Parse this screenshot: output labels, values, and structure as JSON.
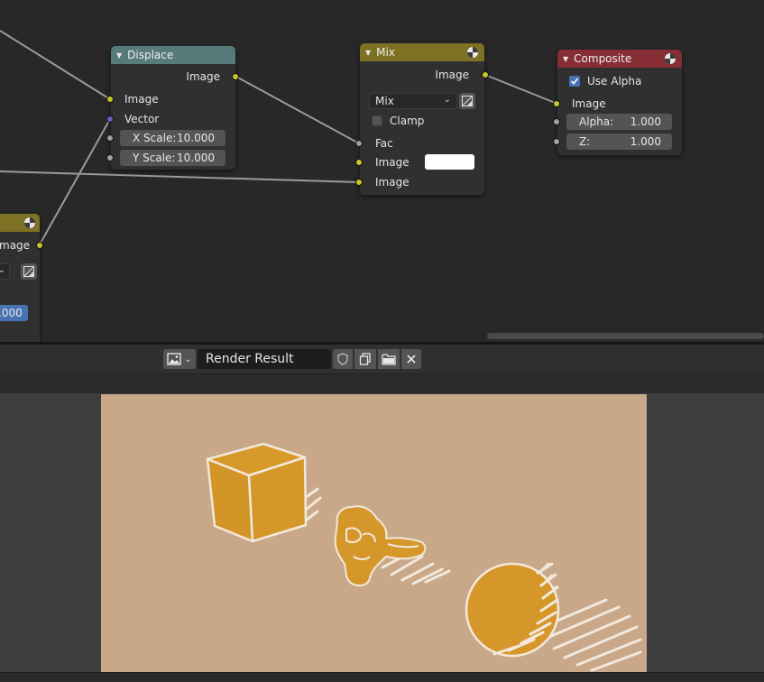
{
  "node_editor": {
    "nodes": {
      "displace": {
        "title": "Displace",
        "output_image": "Image",
        "input_image": "Image",
        "input_vector": "Vector",
        "x_scale_label": "X Scale:",
        "x_scale_value": "10.000",
        "y_scale_label": "Y Scale:",
        "y_scale_value": "10.000",
        "header_color": "#577a7b"
      },
      "mix": {
        "title": "Mix",
        "output_image": "Image",
        "blend_mode": "Mix",
        "clamp_label": "Clamp",
        "clamp_checked": false,
        "input_fac": "Fac",
        "input_image_1": "Image",
        "input_image_2": "Image",
        "color_value": "#ffffff",
        "header_color": "#7d7224"
      },
      "composite": {
        "title": "Composite",
        "use_alpha_label": "Use Alpha",
        "use_alpha_checked": true,
        "input_image": "Image",
        "alpha_label": "Alpha:",
        "alpha_value": "1.000",
        "z_label": "Z:",
        "z_value": "1.000",
        "header_color": "#862d35"
      },
      "left_partial": {
        "output_image": "mage",
        "value": ".000",
        "header_color": "#7d7224"
      }
    }
  },
  "image_editor": {
    "image_name": "Render Result",
    "background_color": "#c8a888",
    "object_color": "#d6972a"
  }
}
